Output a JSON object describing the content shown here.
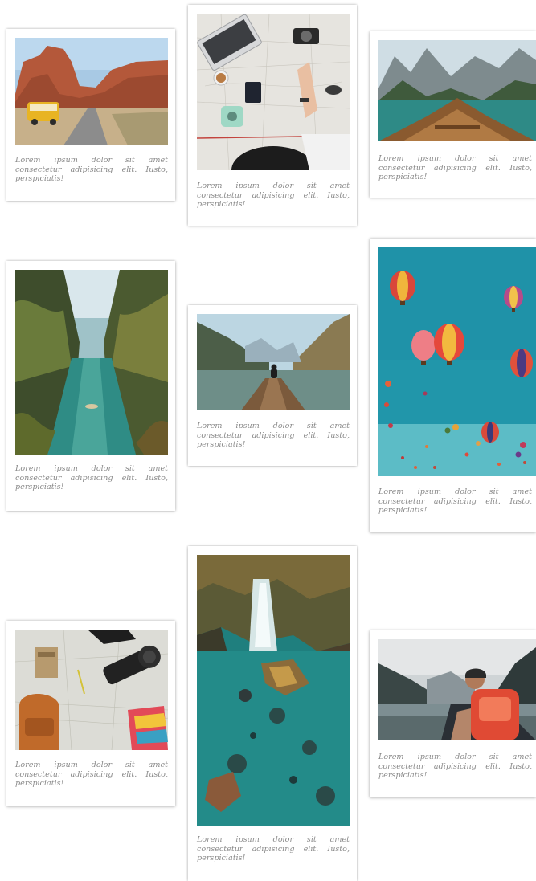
{
  "gallery": {
    "cards": [
      {
        "id": "canyon-road",
        "caption": "Lorem ipsum dolor sit amet consectetur adipisicing elit. Iusto, perspiciatis!"
      },
      {
        "id": "travel-desk",
        "caption": "Lorem ipsum dolor sit amet consectetur adipisicing elit. Iusto, perspiciatis!"
      },
      {
        "id": "lake-boat",
        "caption": "Lorem ipsum dolor sit amet consectetur adipisicing elit. Iusto, perspiciatis!"
      },
      {
        "id": "jungle-river",
        "caption": "Lorem ipsum dolor sit amet consectetur adipisicing elit. Iusto, perspiciatis!"
      },
      {
        "id": "mountain-pier",
        "caption": "Lorem ipsum dolor sit amet consectetur adipisicing elit. Iusto, perspiciatis!"
      },
      {
        "id": "hot-air-balloons",
        "caption": "Lorem ipsum dolor sit amet consectetur adipisicing elit. Iusto, perspiciatis!"
      },
      {
        "id": "map-camera-flatlay",
        "caption": "Lorem ipsum dolor sit amet consectetur adipisicing elit. Iusto, perspiciatis!"
      },
      {
        "id": "waterfall-lagoon",
        "caption": "Lorem ipsum dolor sit amet consectetur adipisicing elit. Iusto, perspiciatis!"
      },
      {
        "id": "hiker-lake",
        "caption": "Lorem ipsum dolor sit amet consectetur adipisicing elit. Iusto, perspiciatis!"
      }
    ]
  }
}
